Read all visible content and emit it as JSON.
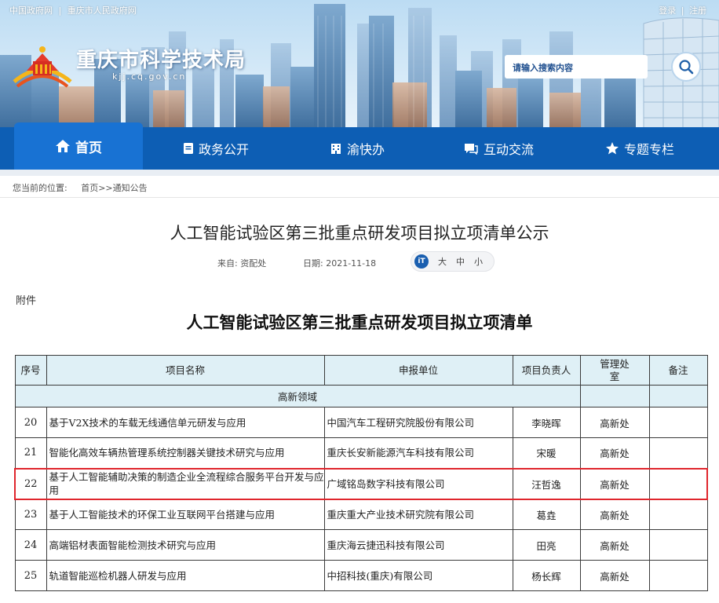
{
  "top_links": [
    "中国政府网",
    "|",
    "重庆市人民政府网"
  ],
  "user_links": [
    "登录",
    "|",
    "注册"
  ],
  "site": {
    "title": "重庆市科学技术局",
    "url": "kjj.cq.gov.cn"
  },
  "search": {
    "placeholder": "请输入搜索内容"
  },
  "nav": [
    {
      "label": "首页",
      "icon": "home-icon"
    },
    {
      "label": "政务公开",
      "icon": "document-icon"
    },
    {
      "label": "渝快办",
      "icon": "building-icon"
    },
    {
      "label": "互动交流",
      "icon": "chat-icon"
    },
    {
      "label": "专题专栏",
      "icon": "star-icon"
    }
  ],
  "breadcrumb": {
    "prefix": "您当前的位置:",
    "path": "首页>>通知公告"
  },
  "article": {
    "title": "人工智能试验区第三批重点研发项目拟立项清单公示",
    "source": "来自: 资配处",
    "date": "日期: 2021-11-18",
    "font_sizes": [
      "大",
      "中",
      "小"
    ],
    "font_icon_label": "iT"
  },
  "document": {
    "annex_label": "附件",
    "title": "人工智能试验区第三批重点研发项目拟立项清单",
    "table": {
      "headers": [
        "序号",
        "项目名称",
        "申报单位",
        "项目负责人",
        "管理处室",
        "备注"
      ],
      "section": "高新领域",
      "rows": [
        {
          "no": "20",
          "name": "基于V2X技术的车载无线通信单元研发与应用",
          "unit": "中国汽车工程研究院股份有限公司",
          "lead": "李晓晖",
          "dept": "高新处",
          "note": ""
        },
        {
          "no": "21",
          "name": "智能化高效车辆热管理系统控制器关键技术研究与应用",
          "unit": "重庆长安新能源汽车科技有限公司",
          "lead": "宋暖",
          "dept": "高新处",
          "note": ""
        },
        {
          "no": "22",
          "name": "基于人工智能辅助决策的制造企业全流程综合服务平台开发与应用",
          "unit": "广域铭岛数字科技有限公司",
          "lead": "汪哲逸",
          "dept": "高新处",
          "note": "",
          "highlighted": true
        },
        {
          "no": "23",
          "name": "基于人工智能技术的环保工业互联网平台搭建与应用",
          "unit": "重庆重大产业技术研究院有限公司",
          "lead": "葛垚",
          "dept": "高新处",
          "note": ""
        },
        {
          "no": "24",
          "name": "高端铝材表面智能检测技术研究与应用",
          "unit": "重庆海云捷迅科技有限公司",
          "lead": "田亮",
          "dept": "高新处",
          "note": ""
        },
        {
          "no": "25",
          "name": "轨道智能巡检机器人研发与应用",
          "unit": "中招科技(重庆)有限公司",
          "lead": "杨长辉",
          "dept": "高新处",
          "note": ""
        }
      ]
    }
  },
  "colors": {
    "nav_bg": "#0d5eb4",
    "nav_active": "#1872d3",
    "highlight_border": "#e0262d",
    "table_header_bg": "#dff0f6"
  }
}
